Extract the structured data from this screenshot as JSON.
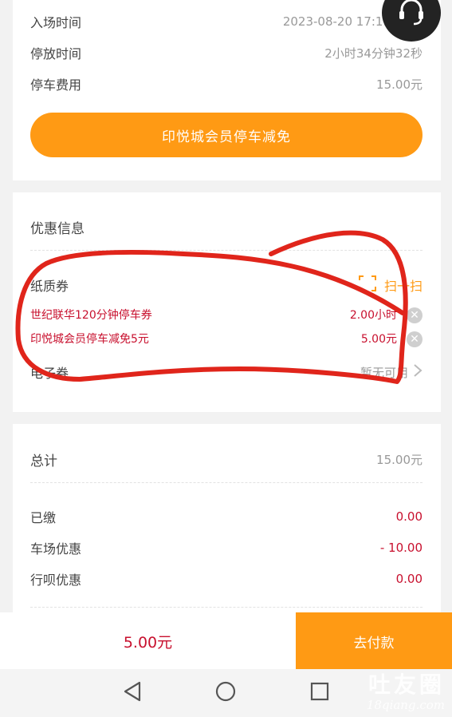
{
  "parking": {
    "entry_label": "入场时间",
    "entry_value": "2023-08-20  17:19",
    "duration_label": "停放时间",
    "duration_value": "2小时34分钟32秒",
    "fee_label": "停车费用",
    "fee_value": "15.00元",
    "member_button": "印悦城会员停车减免"
  },
  "discounts": {
    "title": "优惠信息",
    "paper_label": "纸质券",
    "scan_label": "扫一扫",
    "coupons": [
      {
        "name": "世纪联华120分钟停车券",
        "value": "2.00小时"
      },
      {
        "name": "印悦城会员停车减免5元",
        "value": "5.00元"
      }
    ],
    "ecoupon_label": "电子券",
    "ecoupon_value": "暂无可用"
  },
  "summary": {
    "total_label": "总计",
    "total_value": "15.00元",
    "paid_label": "已缴",
    "paid_value": "0.00",
    "lot_label": "车场优惠",
    "lot_value": "- 10.00",
    "app_label": "行呗优惠",
    "app_value": "0.00"
  },
  "bottom": {
    "amount": "5.00元",
    "pay_label": "去付款"
  },
  "watermark": {
    "line1": "吐友圈",
    "line2": "18qiang.com"
  },
  "colors": {
    "accent": "#ff9a14",
    "price": "#c8102e",
    "annotation": "#e0251b"
  },
  "icons": [
    "customer-service-icon",
    "scan-icon",
    "close-icon",
    "chevron-right-icon",
    "nav-back-icon",
    "nav-home-icon",
    "nav-recents-icon"
  ]
}
